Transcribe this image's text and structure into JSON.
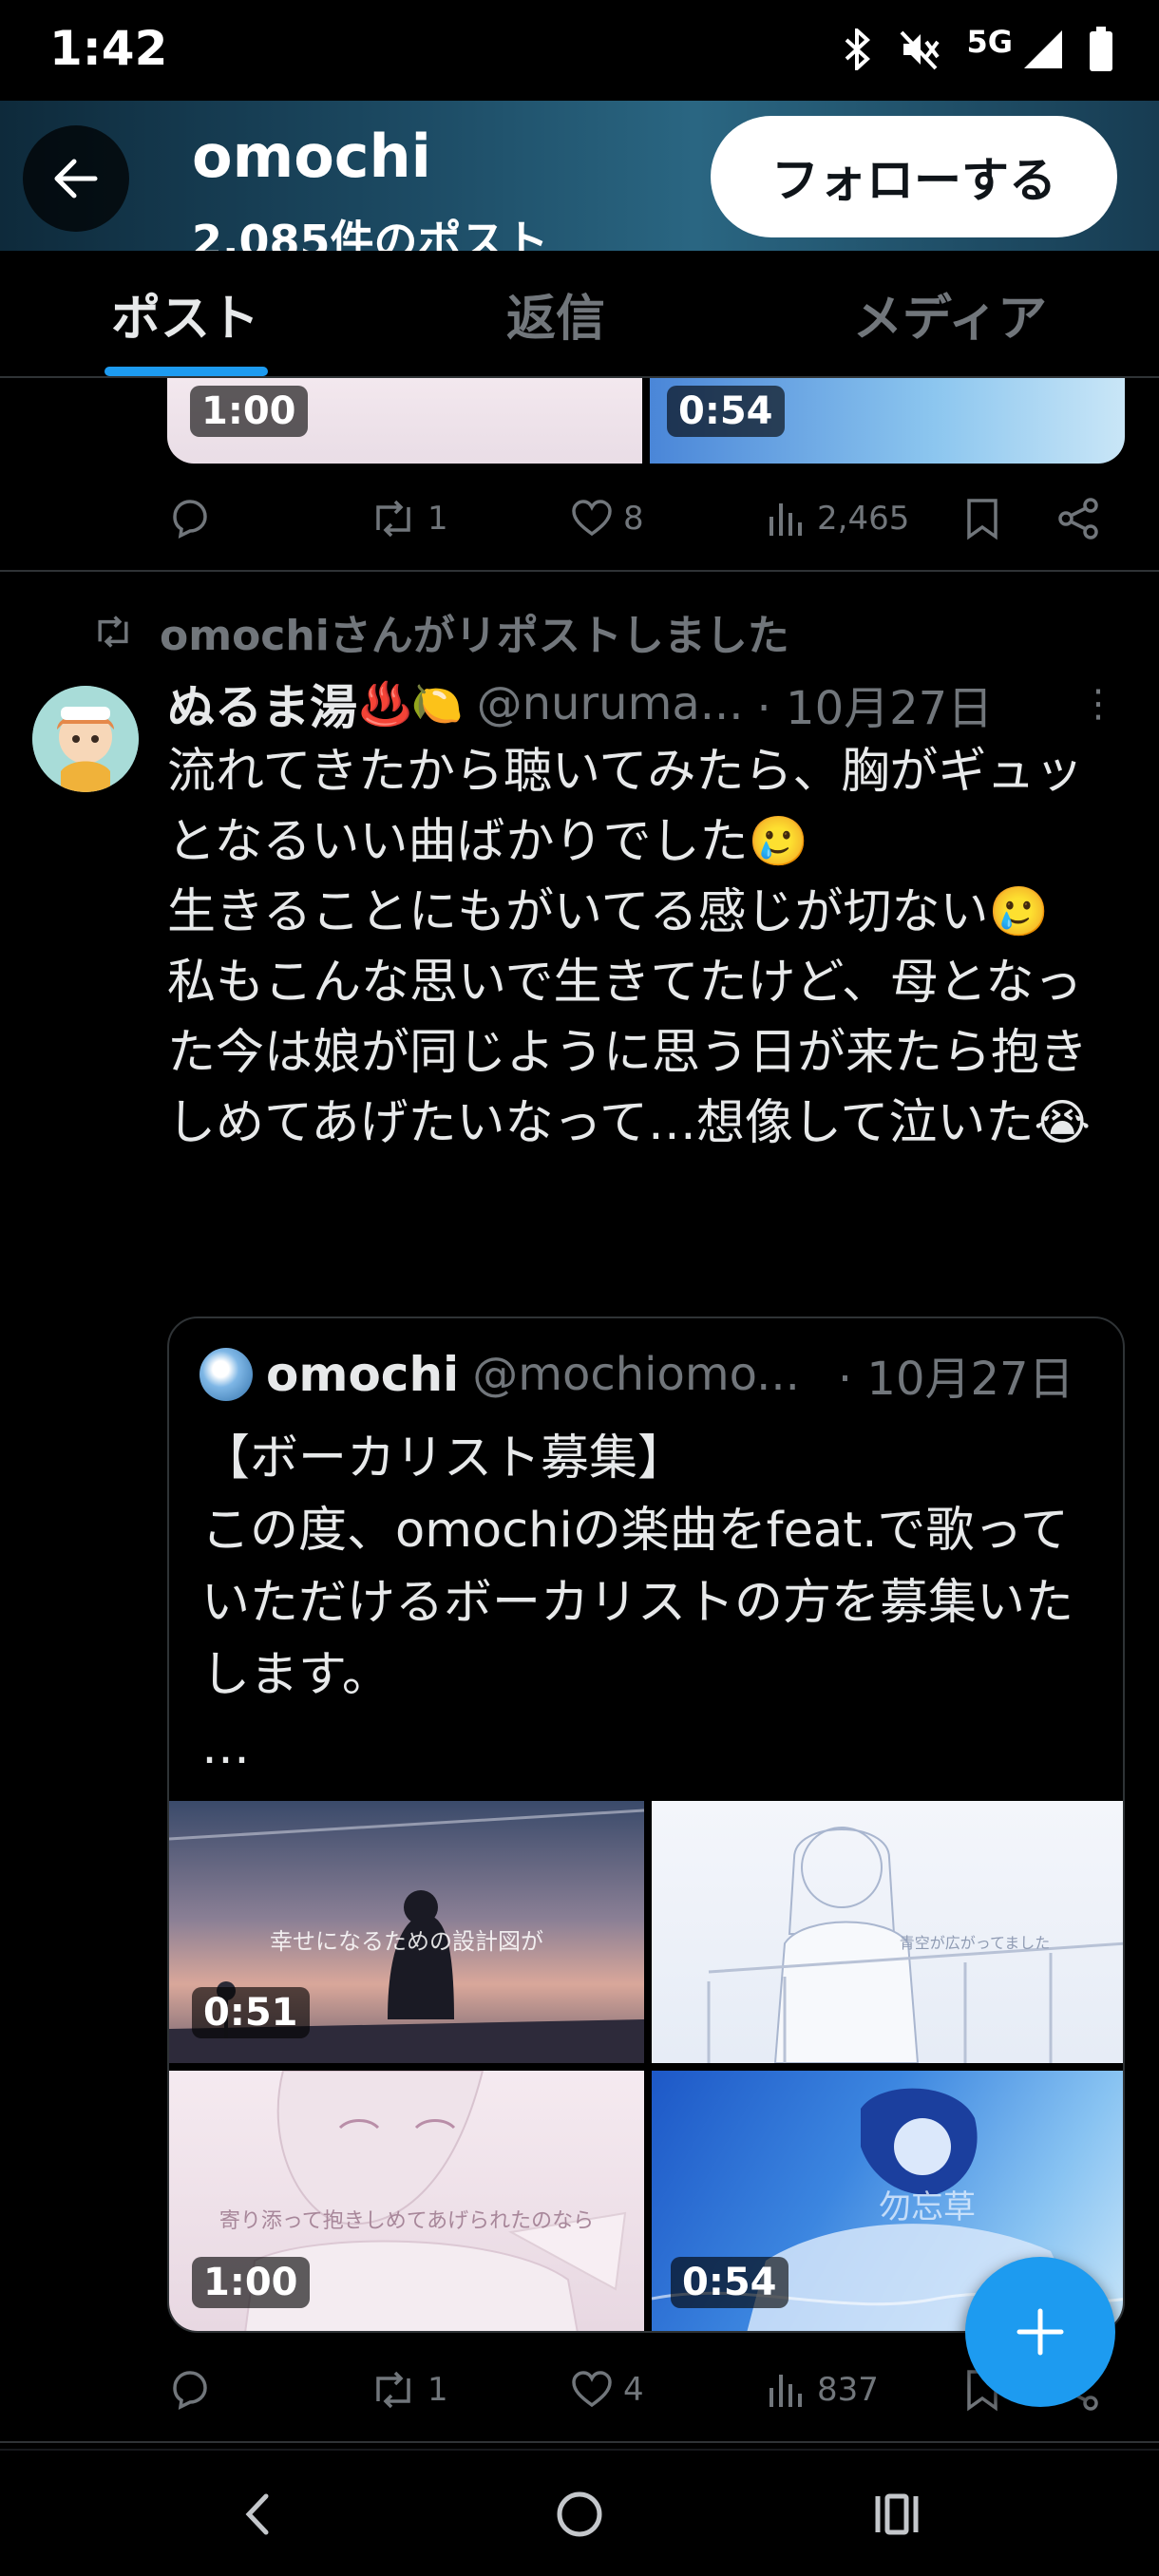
{
  "status_bar": {
    "time": "1:42",
    "network": "5G"
  },
  "header": {
    "name": "omochi",
    "post_count": "2,085件のポスト",
    "follow_label": "フォローする"
  },
  "tabs": [
    {
      "label": "ポスト",
      "active": true
    },
    {
      "label": "返信",
      "active": false
    },
    {
      "label": "メディア",
      "active": false
    }
  ],
  "prev_tweet": {
    "durations": [
      "1:00",
      "0:54"
    ],
    "actions": {
      "reposts": "1",
      "likes": "8",
      "views": "2,465"
    }
  },
  "repost_label": "omochiさんがリポストしました",
  "tweet": {
    "name": "ぬるま湯",
    "name_emoji": "♨️🍋",
    "handle": "@nuruma...",
    "date": "· 10月27日",
    "text": "流れてきたから聴いてみたら、胸がギュッとなるいい曲ばかりでした🥲\n生きることにもがいてる感じが切ない🥲\n私もこんな思いで生きてたけど、母となった今は娘が同じように思う日が来たら抱きしめてあげたいなって…想像して泣いた😭",
    "quote": {
      "name": "omochi",
      "handle": "@mochiomo...",
      "date": "· 10月27日",
      "text": "【ボーカリスト募集】\nこの度、omochiの楽曲をfeat.で歌っていただけるボーカリストの方を募集いたします。\n…",
      "media": [
        {
          "duration": "0:51",
          "caption": "幸せになるための設計図が"
        },
        {
          "duration": "",
          "caption": "青空が広がってました"
        },
        {
          "duration": "1:00",
          "caption": "寄り添って抱きしめてあげられたのなら"
        },
        {
          "duration": "0:54",
          "caption": "勿忘草"
        }
      ]
    },
    "actions": {
      "reposts": "1",
      "likes": "4",
      "views": "837"
    }
  },
  "colors": {
    "accent": "#1d9bf0",
    "muted": "#71767b",
    "background": "#000000",
    "text": "#e7e9ea"
  },
  "icons": [
    "back-arrow-icon",
    "bluetooth-icon",
    "mute-icon",
    "signal-icon",
    "battery-icon",
    "reply-icon",
    "repost-icon",
    "like-icon",
    "views-icon",
    "bookmark-icon",
    "share-icon",
    "plus-icon"
  ]
}
